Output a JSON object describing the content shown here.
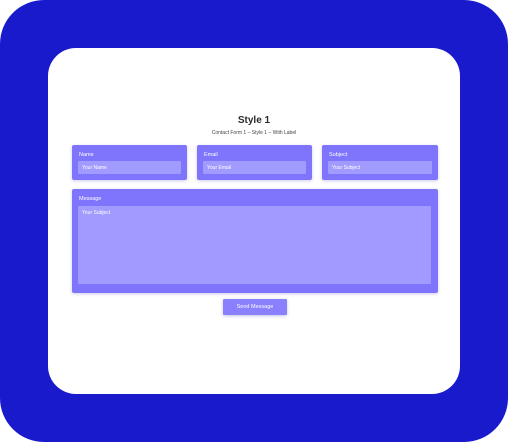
{
  "colors": {
    "frame_background": "#1a1acd",
    "card_background": "#ffffff",
    "field_background": "#7f75fd",
    "input_background": "#a29bff",
    "button_background": "#8a80fd"
  },
  "header": {
    "title": "Style 1",
    "subtitle": "Contact Form 1 – Style 1 – With Label"
  },
  "form": {
    "name": {
      "label": "Name",
      "placeholder": "Your Name"
    },
    "email": {
      "label": "Email",
      "placeholder": "Your Email"
    },
    "subject": {
      "label": "Subject",
      "placeholder": "Your Subject"
    },
    "message": {
      "label": "Message",
      "placeholder": "Your Subject"
    },
    "submit_label": "Send Message"
  }
}
